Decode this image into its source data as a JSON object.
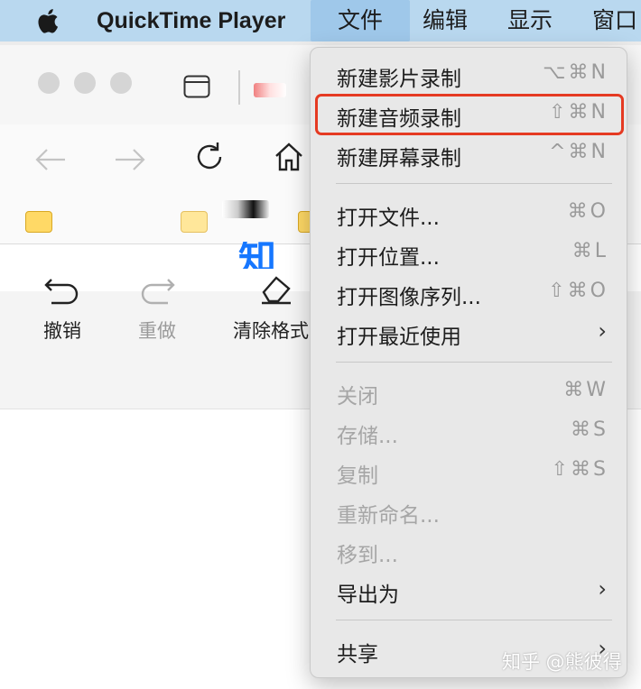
{
  "menubar": {
    "app_name": "QuickTime Player",
    "menus": [
      "文件",
      "编辑",
      "显示",
      "窗口"
    ]
  },
  "browser": {
    "toolbar": {
      "undo": "撤销",
      "redo": "重做",
      "clear_format": "清除格式"
    },
    "page_partial_text": "知"
  },
  "file_menu": {
    "items": [
      {
        "label": "新建影片录制",
        "shortcut": "⌥⌘N",
        "enabled": true
      },
      {
        "label": "新建音频录制",
        "shortcut": "⇧⌘N",
        "enabled": true,
        "highlighted": true
      },
      {
        "label": "新建屏幕录制",
        "shortcut": "^⌘N",
        "enabled": true
      },
      {
        "label": "打开文件...",
        "shortcut": "⌘O",
        "enabled": true
      },
      {
        "label": "打开位置...",
        "shortcut": "⌘L",
        "enabled": true
      },
      {
        "label": "打开图像序列...",
        "shortcut": "⇧⌘O",
        "enabled": true
      },
      {
        "label": "打开最近使用",
        "submenu": true,
        "enabled": true
      },
      {
        "label": "关闭",
        "shortcut": "⌘W",
        "enabled": false
      },
      {
        "label": "存储...",
        "shortcut": "⌘S",
        "enabled": false
      },
      {
        "label": "复制",
        "shortcut": "⇧⌘S",
        "enabled": false
      },
      {
        "label": "重新命名...",
        "enabled": false
      },
      {
        "label": "移到...",
        "enabled": false
      },
      {
        "label": "导出为",
        "submenu": true,
        "enabled": true
      },
      {
        "label": "共享",
        "submenu": true,
        "enabled": true
      }
    ]
  },
  "watermark": "知乎 @熊彼得",
  "colors": {
    "menubar_bg": "#b9d8ef",
    "menu_active_bg": "#9fc8ea",
    "highlight_border": "#e53a22",
    "link_blue": "#1677ff"
  }
}
